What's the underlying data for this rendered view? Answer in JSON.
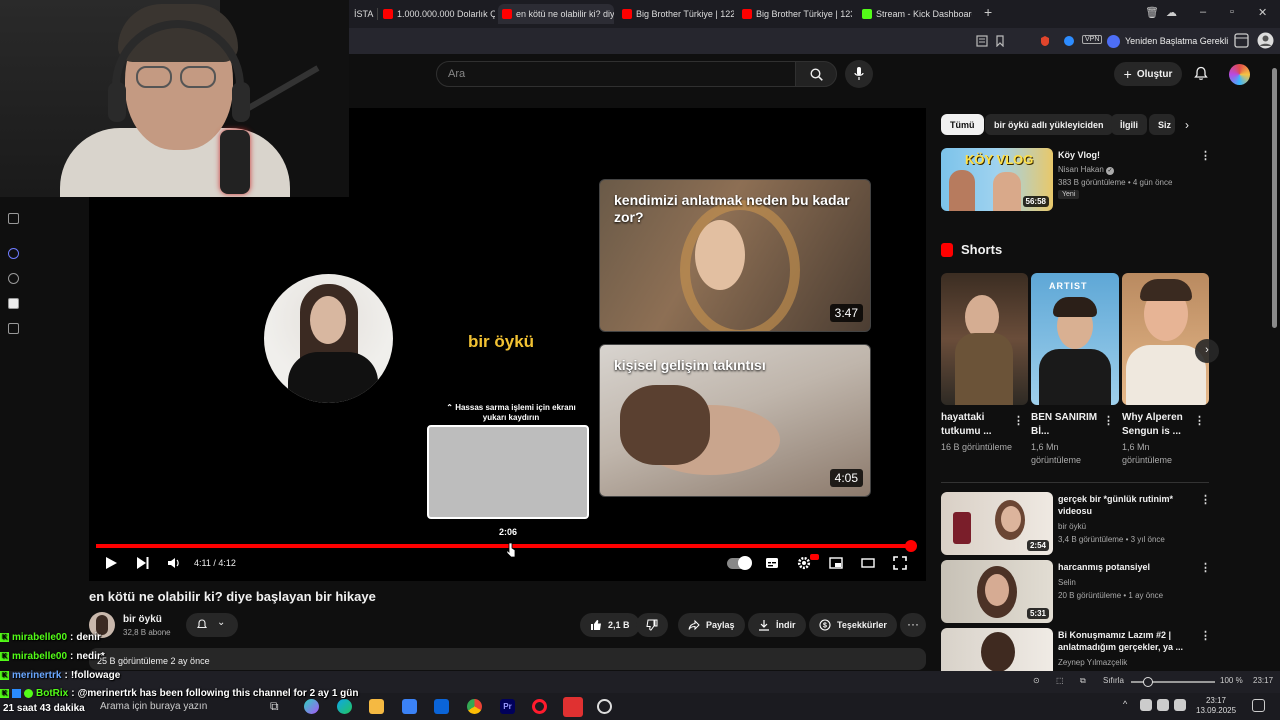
{
  "browser": {
    "tabs": [
      {
        "label": "İSTA",
        "favicon_color": "#2b7bff"
      },
      {
        "label": "1.000.000.000 Dolarlık Çıkı",
        "favicon_color": "#ff0000"
      },
      {
        "label": "en kötü ne olabilir ki? diye",
        "favicon_color": "#ff0000"
      },
      {
        "label": "Big Brother Türkiye | 122. B",
        "favicon_color": "#ff0000"
      },
      {
        "label": "Big Brother Türkiye | 123. B",
        "favicon_color": "#ff0000"
      },
      {
        "label": "Stream - Kick Dashboard",
        "favicon_color": "#53fc18"
      }
    ],
    "vpn_label": "VPN",
    "restart_label": "Yeniden Başlatma Gerekli"
  },
  "youtube": {
    "search_placeholder": "Ara",
    "create_label": "Oluştur"
  },
  "player": {
    "endcard": {
      "channel_name": "bir öykü",
      "cards": [
        {
          "title": "kendimizi anlatmak neden bu kadar zor?",
          "duration": "3:47"
        },
        {
          "title": "kişisel gelişim takıntısı",
          "duration": "4:05"
        }
      ]
    },
    "scrub_hint": "Hassas sarma işlemi için ekranı yukarı kaydırın",
    "scrub_time": "2:06",
    "time_display": "4:11 / 4:12",
    "progress": 0.996
  },
  "video": {
    "title": "en kötü ne olabilir ki? diye başlayan bir hikaye",
    "channel": "bir öykü",
    "subscribers": "32,8 B abone",
    "likes": "2,1 B",
    "share_label": "Paylaş",
    "download_label": "İndir",
    "thanks_label": "Teşekkürler",
    "description_meta": "25 B görüntüleme  2 ay önce"
  },
  "sidebar": {
    "chips": [
      "Tümü",
      "bir öykü adlı yükleyiciden",
      "İlgili",
      "Siz"
    ],
    "top_rec": {
      "title": "Köy Vlog!",
      "channel": "Nisan Hakan",
      "meta": "383 B görüntüleme • 4 gün önce",
      "badge": "Yeni",
      "duration": "56:58",
      "thumb_text": "KÖY VLOG"
    },
    "shorts_heading": "Shorts",
    "shorts": [
      {
        "title": "hayattaki tutkumu ...",
        "views": "16 B görüntüleme"
      },
      {
        "title": "BEN SANIRIM Bİ...",
        "views": "1,6 Mn görüntüleme",
        "overlay": "ARTIST"
      },
      {
        "title": "Why Alperen Sengun is ...",
        "views": "1,6 Mn görüntüleme"
      }
    ],
    "recs": [
      {
        "title": "gerçek bir *günlük rutinim* videosu",
        "channel": "bir öykü",
        "meta": "3,4 B görüntüleme • 3 yıl önce",
        "duration": "2:54"
      },
      {
        "title": "harcanmış potansiyel",
        "channel": "Selin",
        "meta": "20 B görüntüleme • 1 ay önce",
        "duration": "5:31"
      },
      {
        "title": "Bi Konuşmamız Lazım #2 | anlatmadığım gerçekler, ya ...",
        "channel": "Zeynep Yılmazçelik",
        "meta": "",
        "duration": ""
      }
    ]
  },
  "statusbar": {
    "reset_label": "Sıfırla",
    "zoom": "100 %",
    "time": "23:17"
  },
  "taskbar": {
    "search_placeholder": "Arama için buraya yazın",
    "clock_time": "23:17",
    "clock_date": "13.09.2025"
  },
  "chat": {
    "messages": [
      {
        "user": "mirabelle00",
        "text": "denir"
      },
      {
        "user": "mirabelle00",
        "text": "nedir*"
      },
      {
        "user": "merinertrk",
        "text": "!followage"
      },
      {
        "user": "BotRix",
        "text": "@merinertrk has been following this channel for 2 ay 1 gün"
      }
    ],
    "uptime": "21 saat 43 dakika"
  },
  "colors": {
    "youtube_red": "#ff0000",
    "kick_green": "#53fc18",
    "endcard_name": "#f2c233"
  }
}
